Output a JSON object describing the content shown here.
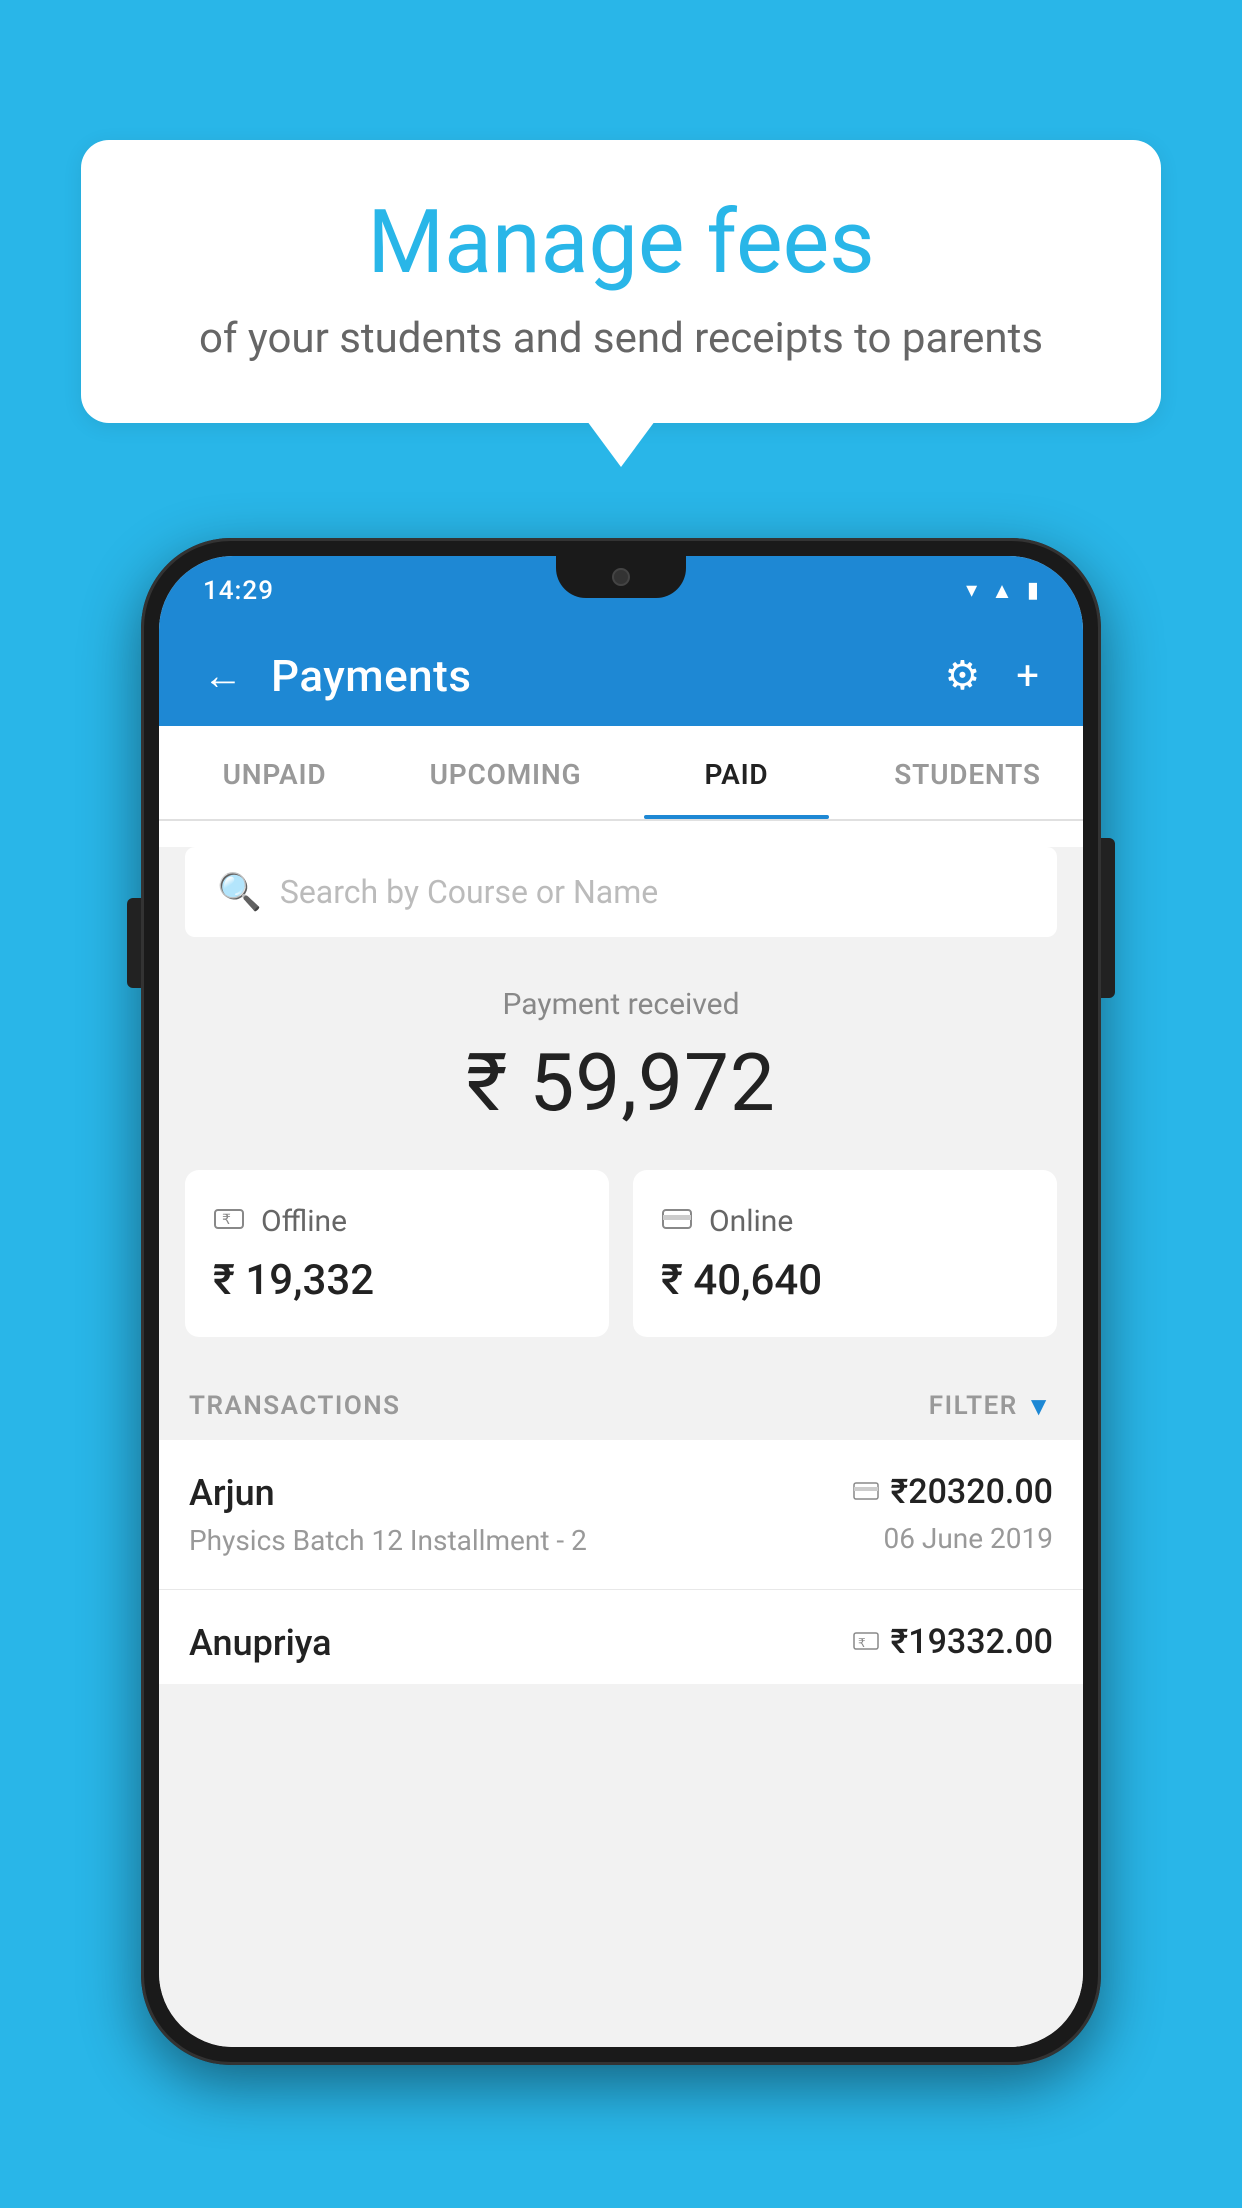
{
  "page": {
    "background_color": "#29B6E8"
  },
  "speech_bubble": {
    "title": "Manage fees",
    "subtitle": "of your students and send receipts to parents"
  },
  "phone": {
    "status_bar": {
      "time": "14:29",
      "icons": [
        "wifi",
        "signal",
        "battery"
      ]
    },
    "header": {
      "back_label": "←",
      "title": "Payments",
      "settings_icon": "⚙",
      "add_icon": "+"
    },
    "tabs": [
      {
        "label": "UNPAID",
        "active": false
      },
      {
        "label": "UPCOMING",
        "active": false
      },
      {
        "label": "PAID",
        "active": true
      },
      {
        "label": "STUDENTS",
        "active": false
      }
    ],
    "search": {
      "placeholder": "Search by Course or Name"
    },
    "payment_received": {
      "label": "Payment received",
      "amount": "₹ 59,972"
    },
    "payment_cards": [
      {
        "icon": "💳",
        "type": "Offline",
        "amount": "₹ 19,332"
      },
      {
        "icon": "💳",
        "type": "Online",
        "amount": "₹ 40,640"
      }
    ],
    "transactions": {
      "section_label": "TRANSACTIONS",
      "filter_label": "FILTER",
      "rows": [
        {
          "name": "Arjun",
          "course": "Physics Batch 12 Installment - 2",
          "payment_icon": "💳",
          "amount": "₹20320.00",
          "date": "06 June 2019"
        },
        {
          "name": "Anupriya",
          "course": "",
          "payment_icon": "💳",
          "amount": "₹19332.00",
          "date": ""
        }
      ]
    }
  }
}
